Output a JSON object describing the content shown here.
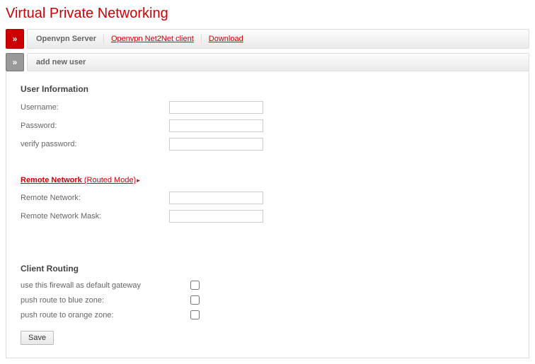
{
  "title": "Virtual Private Networking",
  "topTabs": {
    "toggleGlyph": "»",
    "active": "Openvpn Server",
    "link1": "Openvpn Net2Net client",
    "link2": "Download"
  },
  "subTabs": {
    "toggleGlyph": "»",
    "label": "add new user"
  },
  "sections": {
    "userInfo": {
      "heading": "User Information",
      "usernameLabel": "Username:",
      "passwordLabel": "Password:",
      "verifyLabel": "verify password:"
    },
    "remoteNet": {
      "headingMain": "Remote Network",
      "headingSub": " (Routed Mode)",
      "arrow": "▸",
      "networkLabel": "Remote Network:",
      "maskLabel": "Remote Network Mask:"
    },
    "clientRouting": {
      "heading": "Client Routing",
      "gatewayLabel": "use this firewall as default gateway",
      "blueLabel": "push route to blue zone:",
      "orangeLabel": "push route to orange zone:"
    }
  },
  "buttons": {
    "save": "Save"
  }
}
